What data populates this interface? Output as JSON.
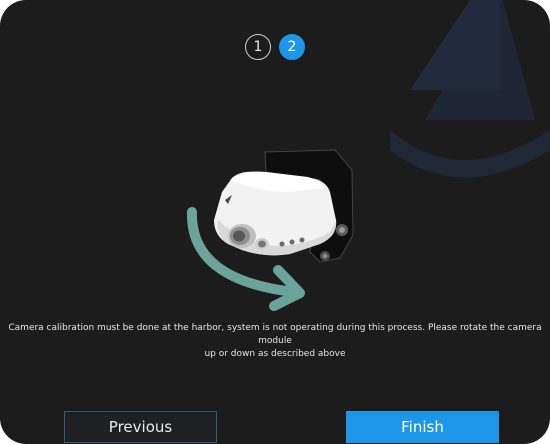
{
  "stepper": {
    "steps": [
      {
        "number": "1",
        "state": "inactive"
      },
      {
        "number": "2",
        "state": "active"
      }
    ]
  },
  "illustration": {
    "subject": "camera-module",
    "arrow": "rotate-arrow",
    "arrow_color": "#6aa39a"
  },
  "instruction": {
    "text": "Camera calibration must be done at the harbor, system is not operating during this process. Please rotate the camera module\nup or down as described above"
  },
  "buttons": {
    "previous_label": "Previous",
    "finish_label": "Finish"
  },
  "colors": {
    "background": "#1c1c1c",
    "accent": "#1e96e8",
    "watermark": "#222a3b"
  }
}
